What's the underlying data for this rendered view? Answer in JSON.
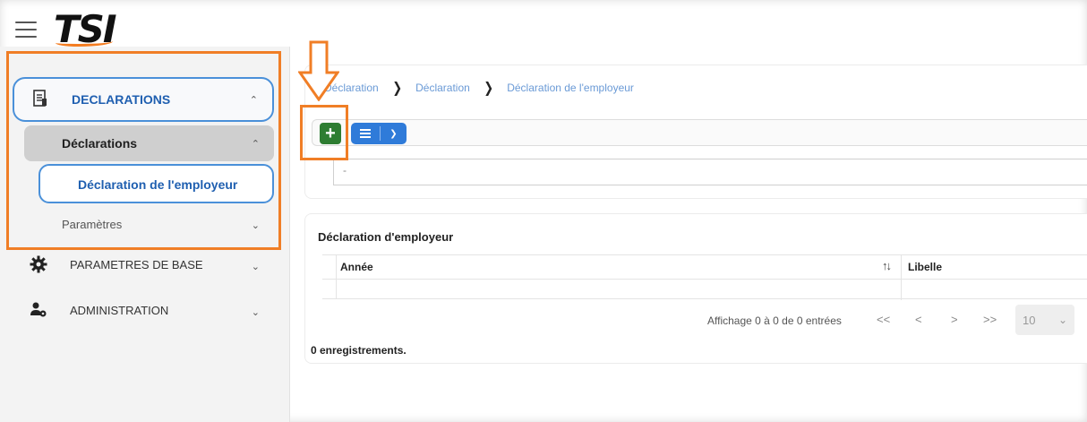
{
  "app": {
    "logo_text": "TSI"
  },
  "colors": {
    "accent_blue": "#2f7bd9",
    "link_blue": "#1f5fb0",
    "add_green": "#2e7d32",
    "highlight_orange": "#f07e26"
  },
  "sidebar": {
    "items": [
      {
        "label": "DECLARATIONS",
        "icon": "document-icon",
        "expanded": true
      },
      {
        "label": "Déclarations",
        "expanded": true
      },
      {
        "label": "Déclaration de l'employeur",
        "active": true
      },
      {
        "label": "Paramètres"
      },
      {
        "label": "PARAMETRES DE BASE",
        "icon": "gear-icon"
      },
      {
        "label": "ADMINISTRATION",
        "icon": "user-gear-icon"
      }
    ]
  },
  "breadcrumb": [
    "Déclaration",
    "Déclaration",
    "Déclaration de l'employeur"
  ],
  "toolbar": {
    "add_label": "+",
    "menu_icon": "list-icon",
    "dropdown_icon": "chevron-down-icon"
  },
  "filter": {
    "value": "-"
  },
  "table": {
    "title": "Déclaration d'employeur",
    "columns": [
      "Année",
      "Libelle"
    ],
    "sort_icon": "↑↓",
    "rows": []
  },
  "pagination": {
    "info": "Affichage 0 à 0 de 0 entrées",
    "first": "<<",
    "prev": "<",
    "next": ">",
    "last": ">>",
    "page_size": "10"
  },
  "records_count": "0 enregistrements."
}
